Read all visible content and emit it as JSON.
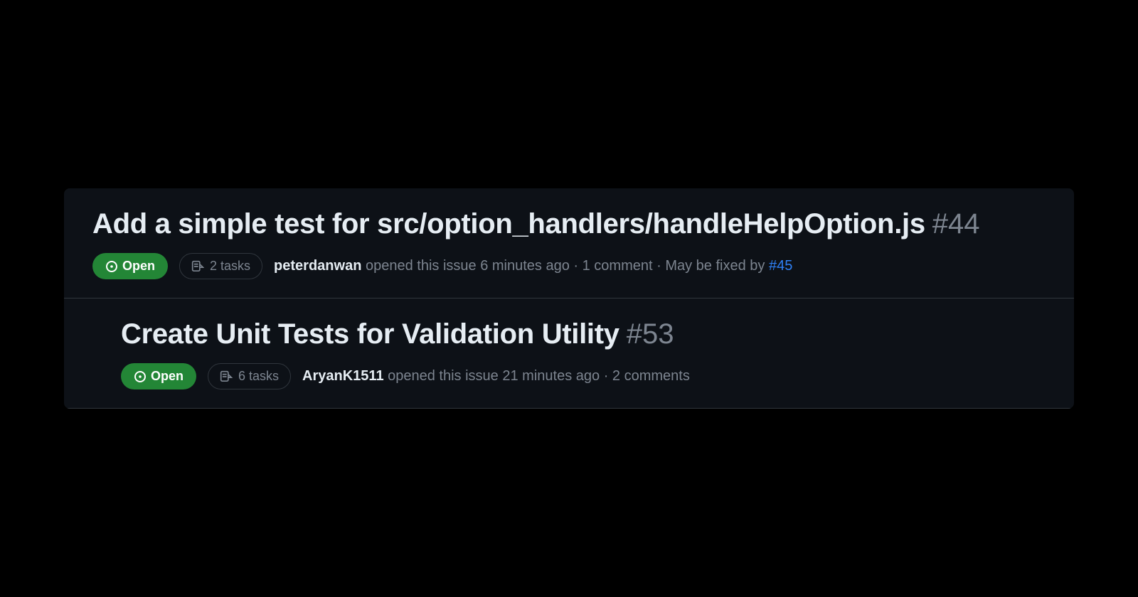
{
  "issues": [
    {
      "title": "Add a simple test for src/option_handlers/handleHelpOption.js",
      "number": "#44",
      "status": "Open",
      "tasks": "2 tasks",
      "author": "peterdanwan",
      "opened_text": "opened this issue 6 minutes ago",
      "comments": "1 comment",
      "fixed_by_prefix": "May be fixed by",
      "fixed_by_link": "#45"
    },
    {
      "title": "Create Unit Tests for Validation Utility",
      "number": "#53",
      "status": "Open",
      "tasks": "6 tasks",
      "author": "AryanK1511",
      "opened_text": "opened this issue 21 minutes ago",
      "comments": "2 comments"
    }
  ]
}
